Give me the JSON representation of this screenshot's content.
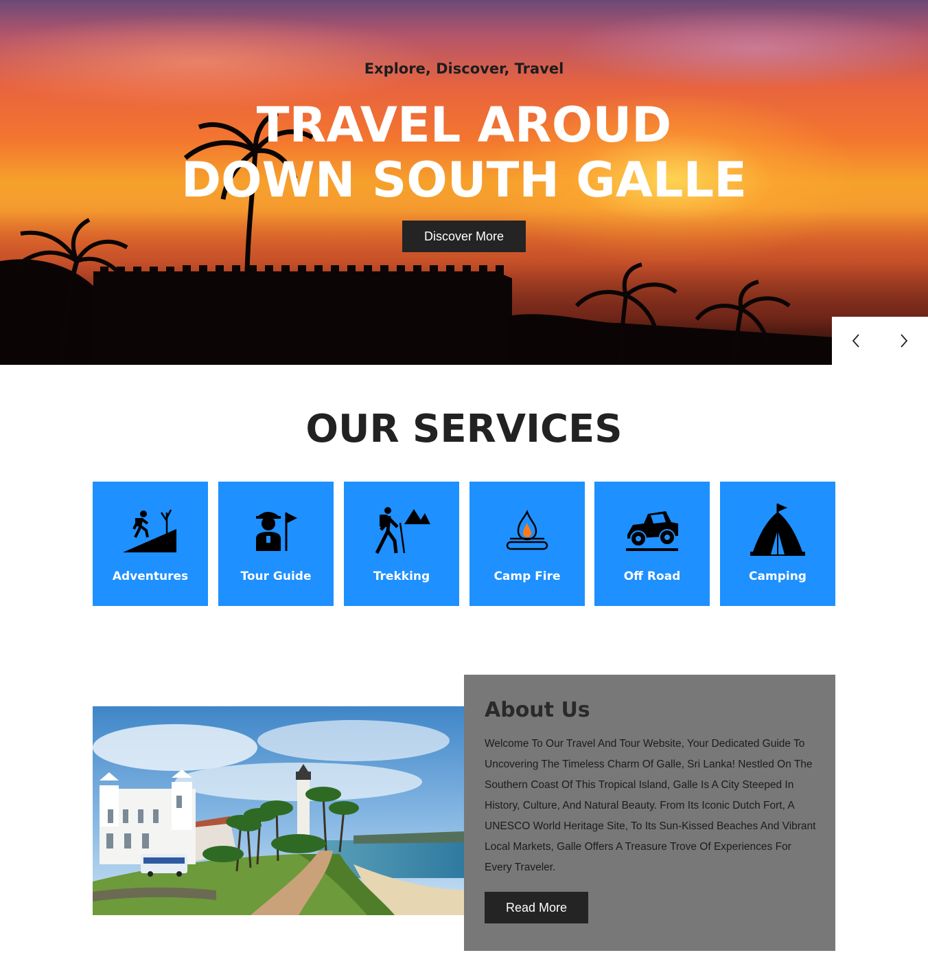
{
  "hero": {
    "subtitle": "Explore, Discover, Travel",
    "title_line1": "TRAVEL AROUD",
    "title_line2": "DOWN SOUTH GALLE",
    "button_label": "Discover More",
    "prev_icon": "chevron-left-icon",
    "next_icon": "chevron-right-icon"
  },
  "services": {
    "title": "OUR SERVICES",
    "items": [
      {
        "label": "Adventures",
        "icon": "hiker-hill-icon"
      },
      {
        "label": "Tour Guide",
        "icon": "tour-guide-flag-icon"
      },
      {
        "label": "Trekking",
        "icon": "trekker-mountain-icon"
      },
      {
        "label": "Camp Fire",
        "icon": "campfire-icon"
      },
      {
        "label": "Off Road",
        "icon": "off-road-jeep-icon"
      },
      {
        "label": "Camping",
        "icon": "tent-icon"
      }
    ]
  },
  "about": {
    "title": "About Us",
    "text": "Welcome To Our Travel And Tour Website, Your Dedicated Guide To Uncovering The Timeless Charm Of Galle, Sri Lanka! Nestled On The Southern Coast Of This Tropical Island, Galle Is A City Steeped In History, Culture, And Natural Beauty. From Its Iconic Dutch Fort, A UNESCO World Heritage Site, To Its Sun-Kissed Beaches And Vibrant Local Markets, Galle Offers A Treasure Trove Of Experiences For Every Traveler.",
    "button_label": "Read More"
  },
  "colors": {
    "service_card": "#1e90ff",
    "button_dark": "#242424",
    "about_panel": "#787878"
  }
}
